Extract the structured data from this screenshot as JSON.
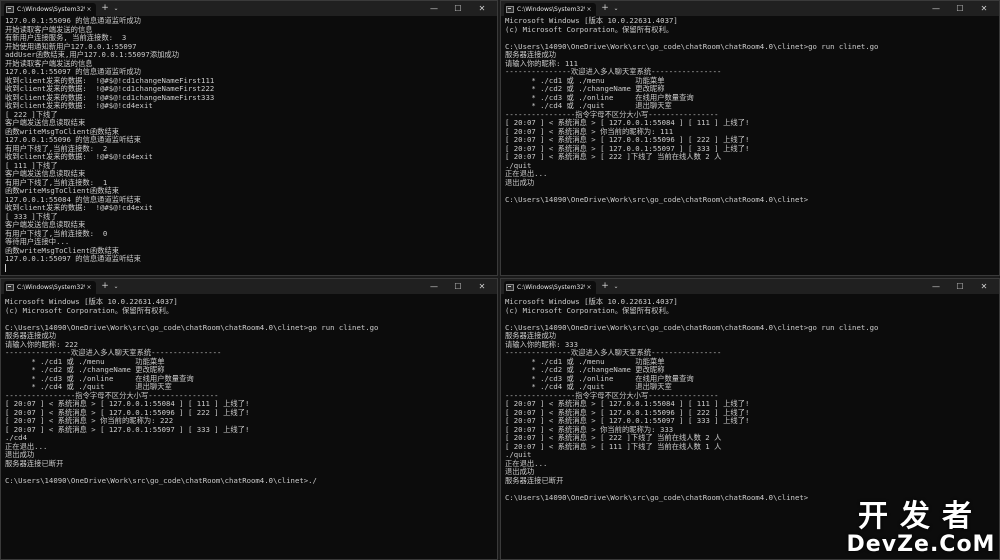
{
  "windows": {
    "tl": {
      "title": "C:\\Windows\\System32\\cmd.e",
      "lines": [
        "127.0.0.1:55096 的信息通道监听成功",
        "开始读取客户端发送的信息",
        "有新用户连接服务, 当前连接数:  3",
        "开始使用通知新用户127.0.0.1:55097",
        "addUser函数结束,用户127.0.0.1:55097添加成功",
        "开始读取客户端发送的信息",
        "127.0.0.1:55097 的信息通道监听成功",
        "收到client发来的数据:  !@#$@!cd1changeNameFirst111",
        "收到client发来的数据:  !@#$@!cd1changeNameFirst222",
        "收到client发来的数据:  !@#$@!cd1changeNameFirst333",
        "收到client发来的数据:  !@#$@!cd4exit",
        "[ 222 ]下线了",
        "客户端发送信息读取结束",
        "函数writeMsgToClient函数结束",
        "127.0.0.1:55096 的信息通道监听结束",
        "有用户下线了,当前连接数:  2",
        "收到client发来的数据:  !@#$@!cd4exit",
        "[ 111 ]下线了",
        "客户端发送信息读取结束",
        "有用户下线了,当前连接数:  1",
        "函数writeMsgToClient函数结束",
        "127.0.0.1:55084 的信息通道监听结束",
        "收到client发来的数据:  !@#$@!cd4exit",
        "[ 333 ]下线了",
        "客户端发送信息读取结束",
        "有用户下线了,当前连接数:  0",
        "等待用户连接中...",
        "函数writeMsgToClient函数结束",
        "127.0.0.1:55097 的信息通道监听结束"
      ]
    },
    "tr": {
      "title": "C:\\Windows\\System32\\cmd.e",
      "lines": [
        "Microsoft Windows [版本 10.0.22631.4037]",
        "(c) Microsoft Corporation。保留所有权利。",
        "",
        "C:\\Users\\14090\\OneDrive\\Work\\src\\go_code\\chatRoom\\chatRoom4.0\\clinet>go run clinet.go",
        "服务器连接成功",
        "请输入你的昵称: 111",
        "---------------欢迎进入多人聊天室系统----------------",
        "      * ./cd1 或 ./menu       功能菜单",
        "      * ./cd2 或 ./changeName 更改昵称",
        "      * ./cd3 或 ./online     在线用户数量查询",
        "      * ./cd4 或 ./quit       退出聊天室",
        "----------------指令字母不区分大小写----------------",
        "[ 20:07 ] < 系统消息 > [ 127.0.0.1:55084 ] [ 111 ] 上线了!",
        "[ 20:07 ] < 系统消息 > 你当前的昵称为: 111",
        "[ 20:07 ] < 系统消息 > [ 127.0.0.1:55096 ] [ 222 ] 上线了!",
        "[ 20:07 ] < 系统消息 > [ 127.0.0.1:55097 ] [ 333 ] 上线了!",
        "[ 20:07 ] < 系统消息 > [ 222 ]下线了 当前在线人数 2 人",
        "./quit",
        "正在退出...",
        "退出成功",
        "",
        "C:\\Users\\14090\\OneDrive\\Work\\src\\go_code\\chatRoom\\chatRoom4.0\\clinet>"
      ]
    },
    "bl": {
      "title": "C:\\Windows\\System32\\cmd.e",
      "lines": [
        "Microsoft Windows [版本 10.0.22631.4037]",
        "(c) Microsoft Corporation。保留所有权利。",
        "",
        "C:\\Users\\14090\\OneDrive\\Work\\src\\go_code\\chatRoom\\chatRoom4.0\\clinet>go run clinet.go",
        "服务器连接成功",
        "请输入你的昵称: 222",
        "---------------欢迎进入多人聊天室系统----------------",
        "      * ./cd1 或 ./menu       功能菜单",
        "      * ./cd2 或 ./changeName 更改昵称",
        "      * ./cd3 或 ./online     在线用户数量查询",
        "      * ./cd4 或 ./quit       退出聊天室",
        "----------------指令字母不区分大小写----------------",
        "[ 20:07 ] < 系统消息 > [ 127.0.0.1:55084 ] [ 111 ] 上线了!",
        "[ 20:07 ] < 系统消息 > [ 127.0.0.1:55096 ] [ 222 ] 上线了!",
        "[ 20:07 ] < 系统消息 > 你当前的昵称为: 222",
        "[ 20:07 ] < 系统消息 > [ 127.0.0.1:55097 ] [ 333 ] 上线了!",
        "./cd4",
        "正在退出...",
        "退出成功",
        "服务器连接已断开",
        "",
        "C:\\Users\\14090\\OneDrive\\Work\\src\\go_code\\chatRoom\\chatRoom4.0\\clinet>./"
      ]
    },
    "br": {
      "title": "C:\\Windows\\System32\\cmd.e",
      "lines": [
        "Microsoft Windows [版本 10.0.22631.4037]",
        "(c) Microsoft Corporation。保留所有权利。",
        "",
        "C:\\Users\\14090\\OneDrive\\Work\\src\\go_code\\chatRoom\\chatRoom4.0\\clinet>go run clinet.go",
        "服务器连接成功",
        "请输入你的昵称: 333",
        "---------------欢迎进入多人聊天室系统----------------",
        "      * ./cd1 或 ./menu       功能菜单",
        "      * ./cd2 或 ./changeName 更改昵称",
        "      * ./cd3 或 ./online     在线用户数量查询",
        "      * ./cd4 或 ./quit       退出聊天室",
        "----------------指令字母不区分大小写----------------",
        "[ 20:07 ] < 系统消息 > [ 127.0.0.1:55084 ] [ 111 ] 上线了!",
        "[ 20:07 ] < 系统消息 > [ 127.0.0.1:55096 ] [ 222 ] 上线了!",
        "[ 20:07 ] < 系统消息 > [ 127.0.0.1:55097 ] [ 333 ] 上线了!",
        "[ 20:07 ] < 系统消息 > 你当前的昵称为: 333",
        "[ 20:07 ] < 系统消息 > [ 222 ]下线了 当前在线人数 2 人",
        "[ 20:07 ] < 系统消息 > [ 111 ]下线了 当前在线人数 1 人",
        "./quit",
        "正在退出...",
        "退出成功",
        "服务器连接已断开",
        "",
        "C:\\Users\\14090\\OneDrive\\Work\\src\\go_code\\chatRoom\\chatRoom4.0\\clinet>"
      ]
    }
  },
  "controls": {
    "close_tab": "×",
    "new_tab": "+",
    "dropdown": "⌄",
    "minimize": "—",
    "maximize": "☐",
    "close": "✕"
  },
  "watermark": {
    "line1": "开发者",
    "line2": "DevZe.CoM"
  }
}
